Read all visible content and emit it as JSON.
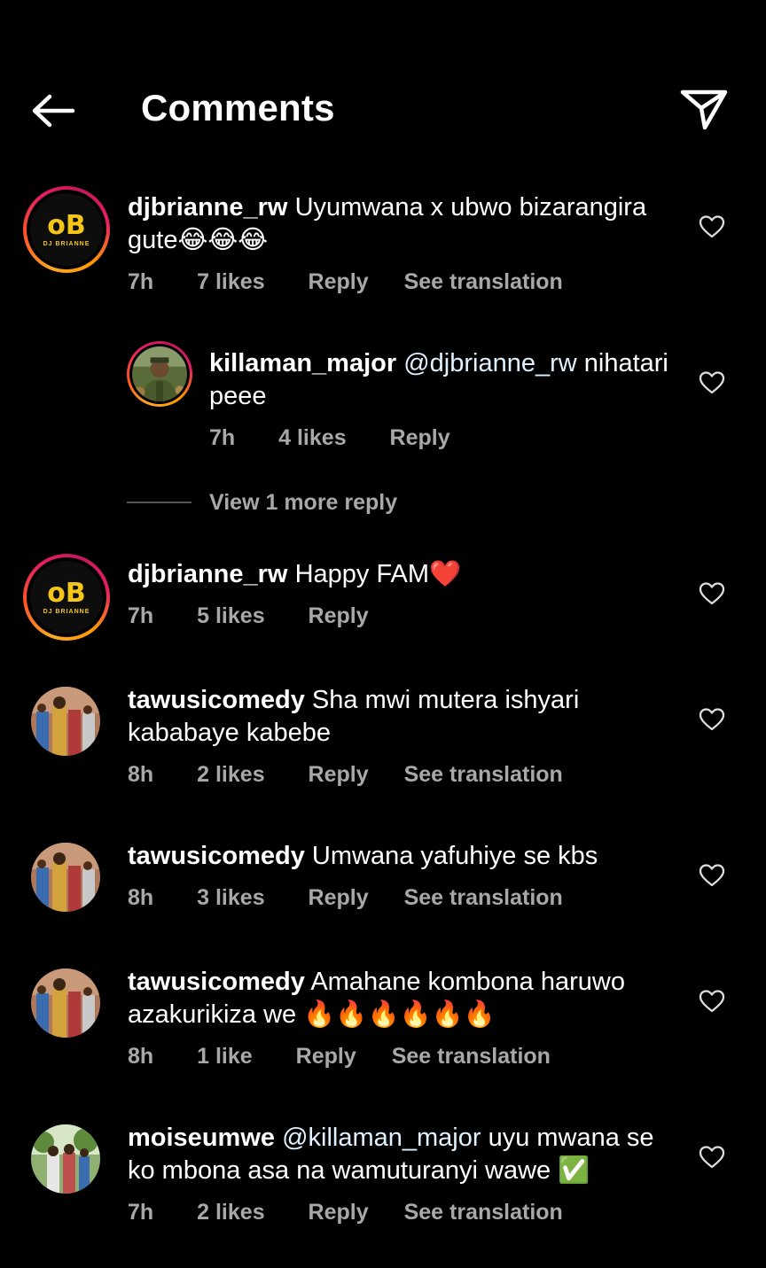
{
  "header": {
    "title": "Comments",
    "back_icon": "arrow-left-icon",
    "share_icon": "paper-plane-icon"
  },
  "view_more_replies": "View 1 more reply",
  "comments": [
    {
      "username": "djbrianne_rw",
      "text": "Uyumwana x ubwo bizarangira gute😂😂😂",
      "time": "7h",
      "likes": "7 likes",
      "reply": "Reply",
      "translation": "See translation",
      "avatar": "dj-brianne-logo"
    },
    {
      "username": "killaman_major",
      "mention": "@djbrianne_rw",
      "text": "nihatari peee",
      "time": "7h",
      "likes": "4 likes",
      "reply": "Reply",
      "avatar": "soldier-photo"
    },
    {
      "username": "djbrianne_rw",
      "text": "Happy FAM❤️",
      "time": "7h",
      "likes": "5 likes",
      "reply": "Reply",
      "avatar": "dj-brianne-logo"
    },
    {
      "username": "tawusicomedy",
      "text": "Sha mwi mutera ishyari kababaye kabebe",
      "time": "8h",
      "likes": "2 likes",
      "reply": "Reply",
      "translation": "See translation",
      "avatar": "group-photo"
    },
    {
      "username": "tawusicomedy",
      "text": "Umwana yafuhiye se kbs",
      "time": "8h",
      "likes": "3 likes",
      "reply": "Reply",
      "translation": "See translation",
      "avatar": "group-photo"
    },
    {
      "username": "tawusicomedy",
      "text": "Amahane kombona haruwo azakurikiza we 🔥🔥🔥🔥🔥🔥",
      "time": "8h",
      "likes": "1 like",
      "reply": "Reply",
      "translation": "See translation",
      "avatar": "group-photo"
    },
    {
      "username": "moiseumwe",
      "mention": "@killaman_major",
      "text": "uyu mwana se ko mbona asa na wamuturanyi wawe ✅",
      "time": "7h",
      "likes": "2 likes",
      "reply": "Reply",
      "translation": "See translation",
      "avatar": "outdoor-group-photo"
    }
  ],
  "dj_logo": {
    "big": "oB",
    "small": "DJ BRIANNE"
  },
  "colors": {
    "background": "#000000",
    "meta_text": "#a8a8a8",
    "logo_gold": "#f5c518"
  }
}
